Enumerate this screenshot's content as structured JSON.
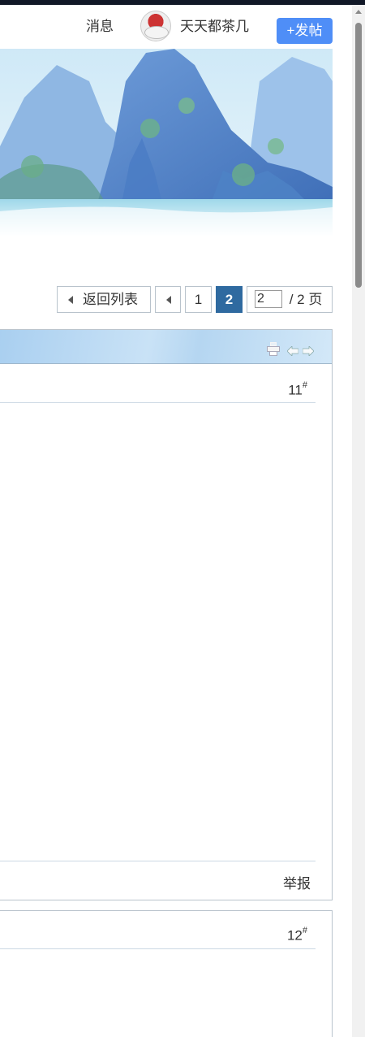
{
  "header": {
    "messages_label": "消息",
    "username": "天天都茶几",
    "post_button_label": "+发帖"
  },
  "pagination": {
    "back_label": "返回列表",
    "pages": [
      "1",
      "2"
    ],
    "current_page": "2",
    "jump_value": "2",
    "total_label": "/ 2 页"
  },
  "posts": [
    {
      "floor_number": "11",
      "floor_mark": "#",
      "report_label": "举报"
    },
    {
      "floor_number": "12",
      "floor_mark": "#"
    }
  ],
  "icons": {
    "toolbar": [
      "print-icon",
      "arrow-left-icon",
      "arrow-right-icon"
    ]
  },
  "colors": {
    "accent_button": "#4f8ef7",
    "current_page": "#2f6aa0",
    "toolbar_gradient_start": "#a9cff0"
  }
}
